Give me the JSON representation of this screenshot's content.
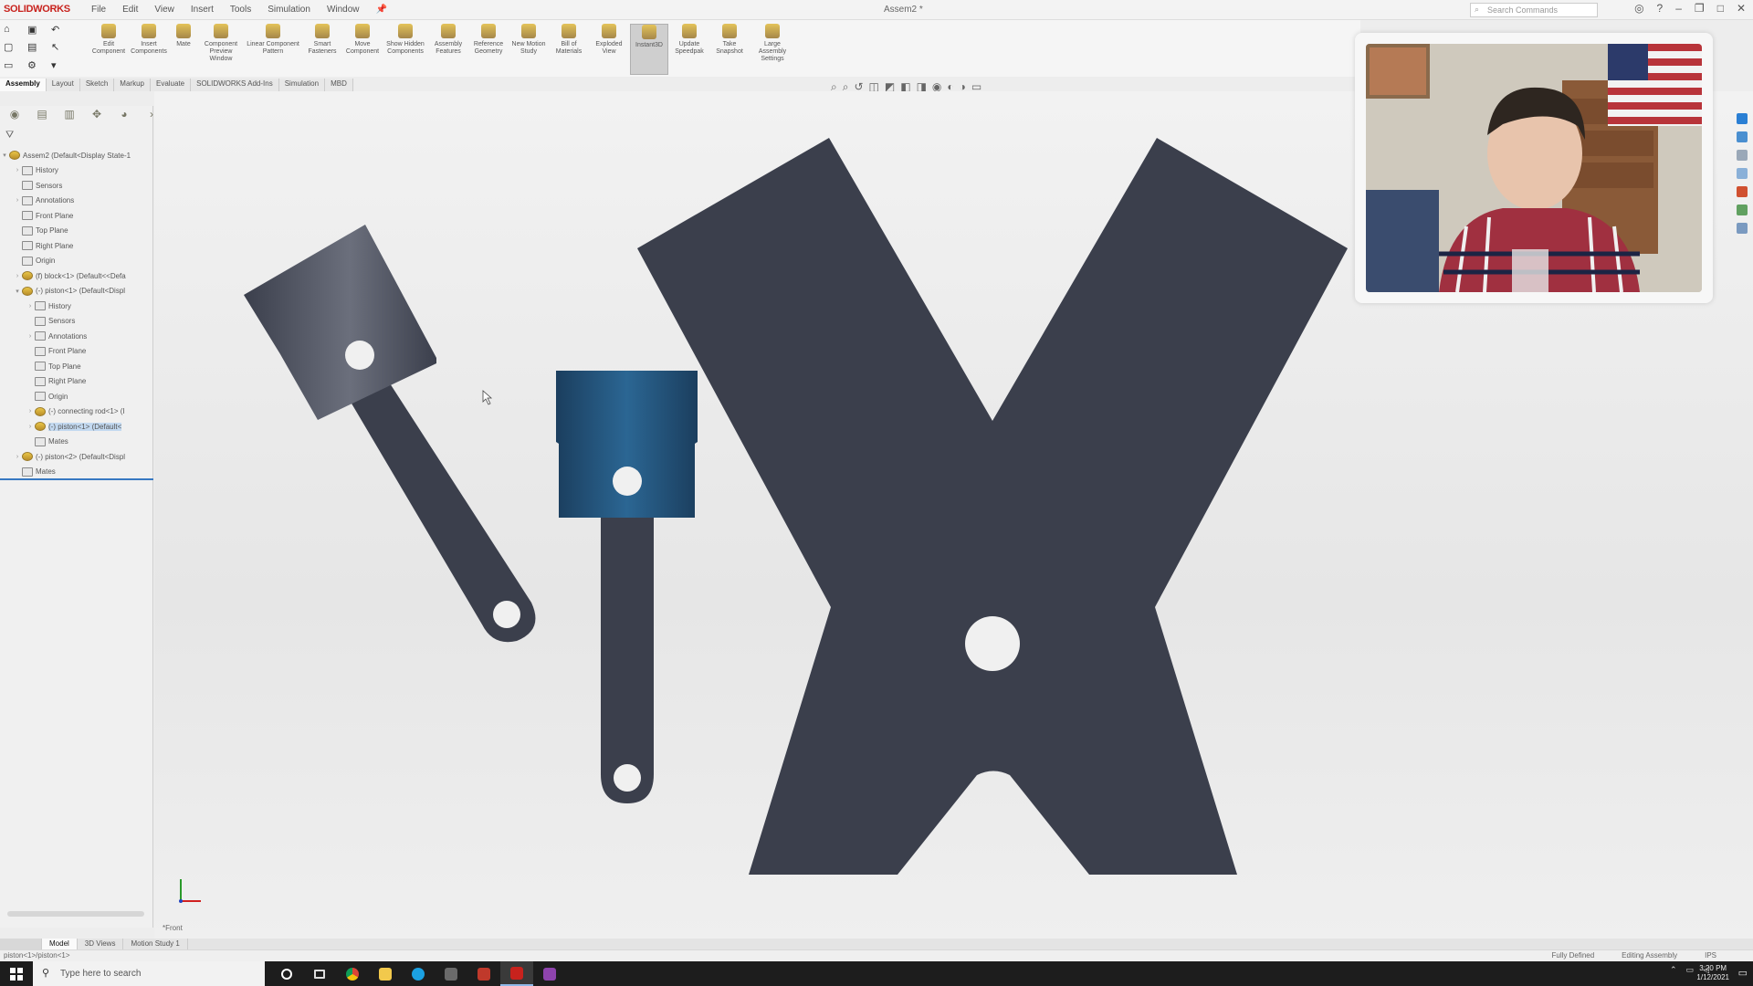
{
  "app": {
    "logo": "SOLIDWORKS",
    "document_title": "Assem2 *",
    "menu": [
      "File",
      "Edit",
      "View",
      "Insert",
      "Tools",
      "Simulation",
      "Window"
    ],
    "search_placeholder": "Search Commands"
  },
  "command_manager": {
    "buttons": [
      {
        "label": "Edit Component",
        "icon": "edit-component-icon"
      },
      {
        "label": "Insert Components",
        "icon": "insert-components-icon"
      },
      {
        "label": "Mate",
        "icon": "mate-icon"
      },
      {
        "label": "Component Preview Window",
        "icon": "preview-window-icon"
      },
      {
        "label": "Linear Component Pattern",
        "icon": "linear-pattern-icon"
      },
      {
        "label": "Smart Fasteners",
        "icon": "smart-fasteners-icon"
      },
      {
        "label": "Move Component",
        "icon": "move-component-icon"
      },
      {
        "label": "Show Hidden Components",
        "icon": "show-hidden-icon"
      },
      {
        "label": "Assembly Features",
        "icon": "assembly-features-icon"
      },
      {
        "label": "Reference Geometry",
        "icon": "reference-geometry-icon"
      },
      {
        "label": "New Motion Study",
        "icon": "motion-study-icon"
      },
      {
        "label": "Bill of Materials",
        "icon": "bom-icon"
      },
      {
        "label": "Exploded View",
        "icon": "exploded-view-icon"
      },
      {
        "label": "Instant3D",
        "icon": "instant3d-icon",
        "active": true
      },
      {
        "label": "Update Speedpak",
        "icon": "speedpak-icon"
      },
      {
        "label": "Take Snapshot",
        "icon": "snapshot-icon"
      },
      {
        "label": "Large Assembly Settings",
        "icon": "large-assembly-icon"
      }
    ]
  },
  "tabs": [
    "Assembly",
    "Layout",
    "Sketch",
    "Markup",
    "Evaluate",
    "SOLIDWORKS Add-Ins",
    "Simulation",
    "MBD"
  ],
  "active_tab": "Assembly",
  "feature_tree": [
    {
      "label": "Assem2  (Default<Display State-1",
      "icon": "assembly",
      "indent": 0,
      "expand": "▾"
    },
    {
      "label": "History",
      "icon": "folder",
      "indent": 1,
      "expand": "›"
    },
    {
      "label": "Sensors",
      "icon": "folder",
      "indent": 1,
      "expand": ""
    },
    {
      "label": "Annotations",
      "icon": "folder",
      "indent": 1,
      "expand": "›"
    },
    {
      "label": "Front Plane",
      "icon": "plane",
      "indent": 1,
      "expand": ""
    },
    {
      "label": "Top Plane",
      "icon": "plane",
      "indent": 1,
      "expand": ""
    },
    {
      "label": "Right Plane",
      "icon": "plane",
      "indent": 1,
      "expand": ""
    },
    {
      "label": "Origin",
      "icon": "origin",
      "indent": 1,
      "expand": ""
    },
    {
      "label": "(f) block<1> (Default<<Defa",
      "icon": "part",
      "indent": 1,
      "expand": "›"
    },
    {
      "label": "(-) piston<1> (Default<Displ",
      "icon": "part",
      "indent": 1,
      "expand": "▾"
    },
    {
      "label": "History",
      "icon": "folder",
      "indent": 2,
      "expand": "›"
    },
    {
      "label": "Sensors",
      "icon": "folder",
      "indent": 2,
      "expand": ""
    },
    {
      "label": "Annotations",
      "icon": "folder",
      "indent": 2,
      "expand": "›"
    },
    {
      "label": "Front Plane",
      "icon": "plane",
      "indent": 2,
      "expand": ""
    },
    {
      "label": "Top Plane",
      "icon": "plane",
      "indent": 2,
      "expand": ""
    },
    {
      "label": "Right Plane",
      "icon": "plane",
      "indent": 2,
      "expand": ""
    },
    {
      "label": "Origin",
      "icon": "origin",
      "indent": 2,
      "expand": ""
    },
    {
      "label": "(-) connecting rod<1> (I",
      "icon": "part",
      "indent": 2,
      "expand": "›"
    },
    {
      "label": "(-) piston<1> (Default<",
      "icon": "part",
      "indent": 2,
      "expand": "›",
      "selected": true
    },
    {
      "label": "Mates",
      "icon": "mates",
      "indent": 2,
      "expand": ""
    },
    {
      "label": "(-) piston<2> (Default<Displ",
      "icon": "part",
      "indent": 1,
      "expand": "›"
    },
    {
      "label": "Mates",
      "icon": "mates",
      "indent": 1,
      "expand": ""
    }
  ],
  "viewport": {
    "rollback_label": "*Front"
  },
  "bottom_tabs": [
    "Model",
    "3D Views",
    "Motion Study 1"
  ],
  "status": {
    "left": "piston<1>/piston<1>",
    "fully_defined": "Fully Defined",
    "editing": "Editing Assembly",
    "units": "IPS"
  },
  "taskbar": {
    "search_placeholder": "Type here to search",
    "time": "3:20 PM",
    "date": "1/12/2021"
  },
  "colors": {
    "model_body": "#3b3f4c",
    "selected_piston": "#1f4e74",
    "accent_blue": "#3778c2",
    "taskbar": "#1d1d1d"
  }
}
